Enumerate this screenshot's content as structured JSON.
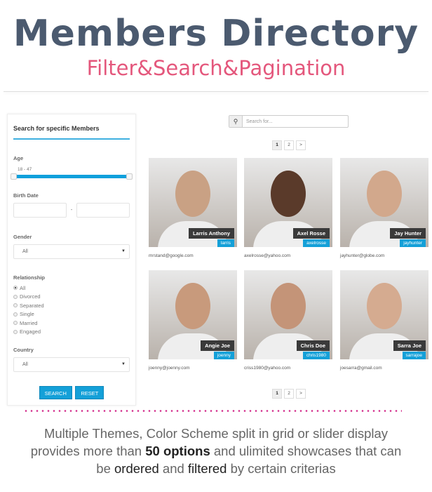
{
  "header": {
    "title": "Members Directory",
    "subtitle": "Filter&Search&Pagination"
  },
  "sidebar": {
    "heading": "Search for specific Members",
    "age_label": "Age",
    "age_range": "18 - 47",
    "age_min": 18,
    "age_max": 47,
    "birth_label": "Birth Date",
    "birth_sep": "-",
    "gender_label": "Gender",
    "gender_value": "All",
    "relationship_label": "Relationship",
    "relationships": [
      "All",
      "Divorced",
      "Separated",
      "Single",
      "Married",
      "Engaged"
    ],
    "relationship_selected": "All",
    "country_label": "Country",
    "country_value": "All",
    "search_button": "SEARCH",
    "reset_button": "RESET",
    "accent": "#14a0d8"
  },
  "search": {
    "placeholder": "Search for...",
    "icon": "search-icon"
  },
  "pagination": {
    "pages": [
      "1",
      "2",
      ">"
    ],
    "current": "1"
  },
  "members": [
    {
      "name": "Larris Anthony",
      "username": "larris",
      "email": "mrstand@google.com"
    },
    {
      "name": "Axel Rosse",
      "username": "axelrosse",
      "email": "axelrosse@yahoo.com"
    },
    {
      "name": "Jay Hunter",
      "username": "jayhunter",
      "email": "jayhunter@globe.com"
    },
    {
      "name": "Angie Joe",
      "username": "joenny",
      "email": "joenny@joenny.com"
    },
    {
      "name": "Chris Doe",
      "username": "chris1980",
      "email": "criss1980@yahoo.com"
    },
    {
      "name": "Sarra Joe",
      "username": "sarrajoe",
      "email": "joesarra@gmail.com"
    }
  ],
  "footer": {
    "l1a": "Multiple Themes, Color Scheme split in grid or slider display",
    "l2a": "provides more than ",
    "l2b": "50 options",
    "l2c": " and ulimited showcases that can",
    "l3a": "be ",
    "l3b": "ordered",
    "l3c": " and ",
    "l3d": "filtered",
    "l3e": " by certain criterias"
  }
}
